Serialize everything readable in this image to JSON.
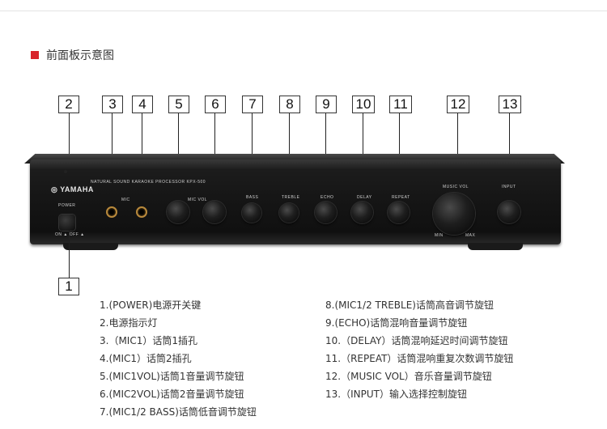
{
  "section_title": "前面板示意图",
  "callouts": [
    "2",
    "3",
    "4",
    "5",
    "6",
    "7",
    "8",
    "9",
    "10",
    "11",
    "12",
    "13"
  ],
  "callout_bottom": "1",
  "amp_labels": {
    "brand": "YAMAHA",
    "model_line": "NATURAL SOUND KARAOKE PROCESSOR  KPX-500",
    "power": "POWER",
    "power_switch": "ON ▲ OFF ▲",
    "mic": "MIC",
    "mic_vol": "MIC VOL",
    "bass": "BASS",
    "treble": "TREBLE",
    "echo": "ECHO",
    "delay": "DELAY",
    "repeat": "REPEAT",
    "music_vol": "MUSIC VOL",
    "input": "INPUT",
    "min": "MIN",
    "max": "MAX"
  },
  "legend_left": [
    "1.(POWER)电源开关键",
    "2.电源指示灯",
    "3.（MIC1）话筒1插孔",
    "4.(MIC1）话筒2插孔",
    "5.(MIC1VOL)话筒1音量调节旋钮",
    "6.(MIC2VOL)话筒2音量调节旋钮",
    "7.(MIC1/2 BASS)话筒低音调节旋钮"
  ],
  "legend_right": [
    "8.(MIC1/2 TREBLE)话筒高音调节旋钮",
    "9.(ECHO)话筒混响音量调节旋钮",
    "10.（DELAY）话筒混响延迟时间调节旋钮",
    "11.（REPEAT）话筒混响重复次数调节旋钮",
    "12.（MUSIC VOL）音乐音量调节旋钮",
    "13.（INPUT）输入选择控制旋钮"
  ]
}
